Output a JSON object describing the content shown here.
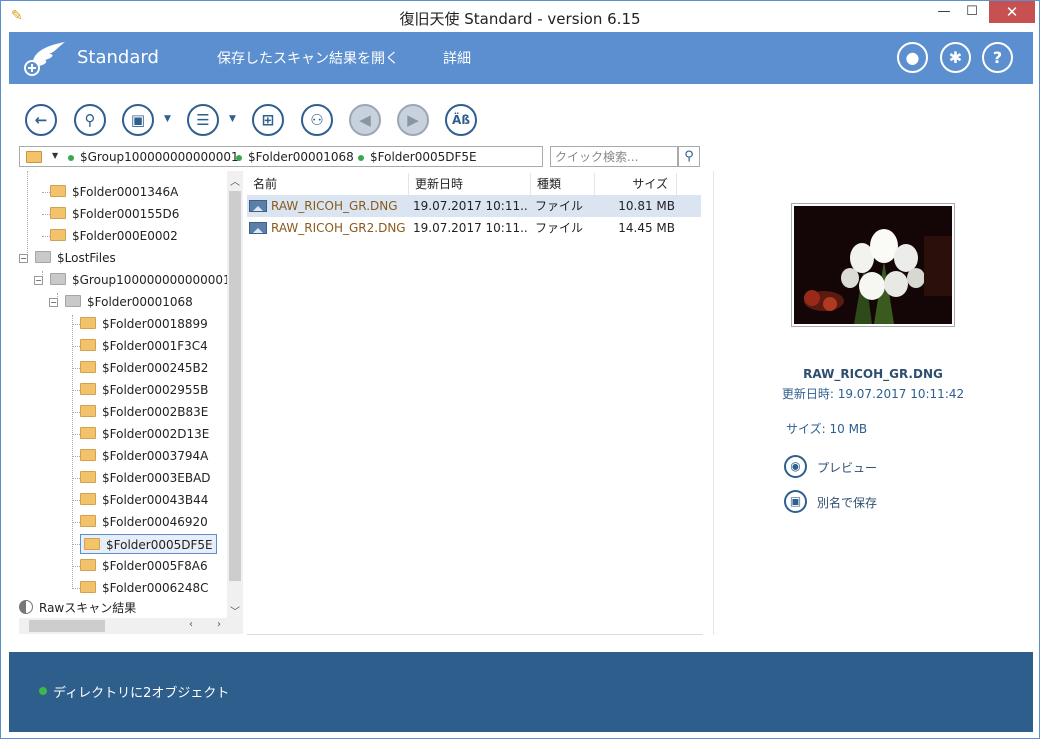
{
  "window": {
    "title": "復旧天使 Standard - version 6.15",
    "minimize": "—",
    "maximize": "☐",
    "close": "✕"
  },
  "header": {
    "brand": "Standard",
    "menu": [
      "保存したスキャン結果を開く",
      "詳細"
    ],
    "icons": [
      "user-icon",
      "gear-icon",
      "help-icon"
    ]
  },
  "toolbar": {
    "buttons": [
      "back-icon",
      "search-icon",
      "save-icon",
      "checklist-icon",
      "view-grid-icon",
      "find-icon",
      "prev-icon",
      "next-icon",
      "text-icon"
    ],
    "text_button": "Äß"
  },
  "path": {
    "crumbs": [
      "$Group100000000000001",
      "$Folder00001068",
      "$Folder0005DF5E"
    ]
  },
  "search": {
    "placeholder": "クイック検索..."
  },
  "tree": {
    "items": [
      {
        "label": "$Folder0001346A",
        "depth": 1,
        "color": "yellow"
      },
      {
        "label": "$Folder000155D6",
        "depth": 1,
        "color": "yellow"
      },
      {
        "label": "$Folder000E0002",
        "depth": 1,
        "color": "yellow"
      },
      {
        "label": "$LostFiles",
        "depth": 0,
        "color": "grey",
        "expander": "−"
      },
      {
        "label": "$Group100000000000001",
        "depth": 1,
        "color": "grey",
        "expander": "−"
      },
      {
        "label": "$Folder00001068",
        "depth": 2,
        "color": "grey",
        "expander": "−"
      },
      {
        "label": "$Folder00018899",
        "depth": 3,
        "color": "yellow"
      },
      {
        "label": "$Folder0001F3C4",
        "depth": 3,
        "color": "yellow"
      },
      {
        "label": "$Folder000245B2",
        "depth": 3,
        "color": "yellow"
      },
      {
        "label": "$Folder0002955B",
        "depth": 3,
        "color": "yellow"
      },
      {
        "label": "$Folder0002B83E",
        "depth": 3,
        "color": "yellow"
      },
      {
        "label": "$Folder0002D13E",
        "depth": 3,
        "color": "yellow"
      },
      {
        "label": "$Folder0003794A",
        "depth": 3,
        "color": "yellow"
      },
      {
        "label": "$Folder0003EBAD",
        "depth": 3,
        "color": "yellow"
      },
      {
        "label": "$Folder00043B44",
        "depth": 3,
        "color": "yellow"
      },
      {
        "label": "$Folder00046920",
        "depth": 3,
        "color": "yellow"
      },
      {
        "label": "$Folder0005DF5E",
        "depth": 3,
        "color": "yellow",
        "selected": true
      },
      {
        "label": "$Folder0005F8A6",
        "depth": 3,
        "color": "yellow"
      },
      {
        "label": "$Folder0006248C",
        "depth": 3,
        "color": "yellow"
      }
    ],
    "raw_label": "Rawスキャン結果"
  },
  "filelist": {
    "columns": [
      "名前",
      "更新日時",
      "種類",
      "サイズ"
    ],
    "rows": [
      {
        "name": "RAW_RICOH_GR.DNG",
        "date": "19.07.2017 10:11...",
        "type": "ファイル",
        "size": "10.81 MB"
      },
      {
        "name": "RAW_RICOH_GR2.DNG",
        "date": "19.07.2017 10:11...",
        "type": "ファイル",
        "size": "14.45 MB"
      }
    ]
  },
  "preview": {
    "filename": "RAW_RICOH_GR.DNG",
    "modified": "更新日時: 19.07.2017 10:11:42",
    "size": "サイズ: 10 MB",
    "preview_label": "プレビュー",
    "save_as_label": "別名で保存"
  },
  "status": {
    "text": "ディレクトリに2オブジェクト"
  },
  "colors": {
    "header": "#5b8fcf",
    "status": "#2d5e8c",
    "accent": "#2e5f8f"
  }
}
